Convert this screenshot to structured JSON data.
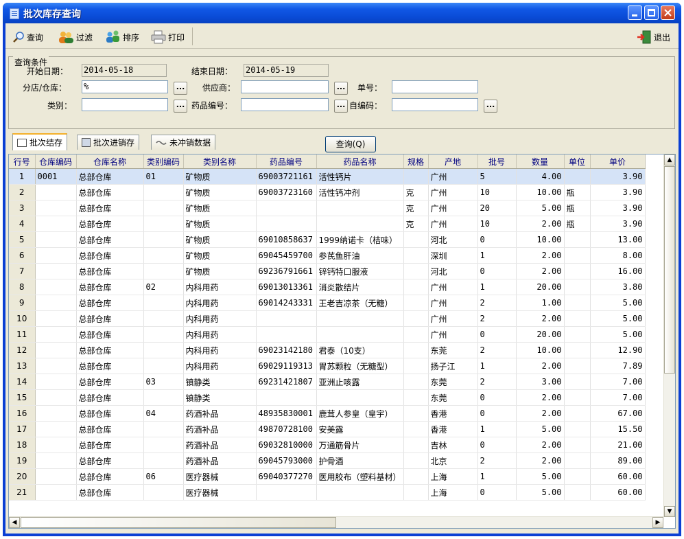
{
  "window": {
    "title": "批次库存查询"
  },
  "toolbar": {
    "query": "查询",
    "filter": "过滤",
    "sort": "排序",
    "print": "打印",
    "exit": "退出"
  },
  "conditions": {
    "group_title": "查询条件",
    "start_date_label": "开始日期：",
    "start_date": "2014-05-18",
    "end_date_label": "结束日期：",
    "end_date": "2014-05-19",
    "store_label": "分店/仓库：",
    "store": "%",
    "supplier_label": "供应商：",
    "supplier": "",
    "order_label": "单号：",
    "order_no": "",
    "category_label": "类别：",
    "category": "",
    "drug_code_label": "药品编号：",
    "drug_code": "",
    "self_code_label": "自编码：",
    "self_code": "",
    "ellipsis": "..."
  },
  "tabs": [
    "批次结存",
    "批次进销存",
    "未冲销数据"
  ],
  "query_button": "查询(Q)",
  "table": {
    "headers": [
      "行号",
      "仓库编码",
      "仓库名称",
      "类别编码",
      "类别名称",
      "药品编号",
      "药品名称",
      "规格",
      "产地",
      "批号",
      "数量",
      "单位",
      "单价"
    ],
    "rows": [
      [
        "1",
        "0001",
        "总部仓库",
        "01",
        "矿物质",
        "69003721161",
        "活性钙片",
        "",
        "广州",
        "5",
        "4.00",
        "",
        "3.90"
      ],
      [
        "2",
        "",
        "总部仓库",
        "",
        "矿物质",
        "69003723160",
        "活性钙冲剂",
        "克",
        "广州",
        "10",
        "10.00",
        "瓶",
        "3.90"
      ],
      [
        "3",
        "",
        "总部仓库",
        "",
        "矿物质",
        "",
        "",
        "克",
        "广州",
        "20",
        "5.00",
        "瓶",
        "3.90"
      ],
      [
        "4",
        "",
        "总部仓库",
        "",
        "矿物质",
        "",
        "",
        "克",
        "广州",
        "10",
        "2.00",
        "瓶",
        "3.90"
      ],
      [
        "5",
        "",
        "总部仓库",
        "",
        "矿物质",
        "69010858637",
        "1999纳诺卡（桔味）",
        "",
        "河北",
        "0",
        "10.00",
        "",
        "13.00"
      ],
      [
        "6",
        "",
        "总部仓库",
        "",
        "矿物质",
        "69045459700",
        "参芪鱼肝油",
        "",
        "深圳",
        "1",
        "2.00",
        "",
        "8.00"
      ],
      [
        "7",
        "",
        "总部仓库",
        "",
        "矿物质",
        "69236791661",
        "锌钙特口服液",
        "",
        "河北",
        "0",
        "2.00",
        "",
        "16.00"
      ],
      [
        "8",
        "",
        "总部仓库",
        "02",
        "内科用药",
        "69013013361",
        "消炎散结片",
        "",
        "广州",
        "1",
        "20.00",
        "",
        "3.80"
      ],
      [
        "9",
        "",
        "总部仓库",
        "",
        "内科用药",
        "69014243331",
        "王老吉凉茶（无糖）",
        "",
        "广州",
        "2",
        "1.00",
        "",
        "5.00"
      ],
      [
        "10",
        "",
        "总部仓库",
        "",
        "内科用药",
        "",
        "",
        "",
        "广州",
        "2",
        "2.00",
        "",
        "5.00"
      ],
      [
        "11",
        "",
        "总部仓库",
        "",
        "内科用药",
        "",
        "",
        "",
        "广州",
        "0",
        "20.00",
        "",
        "5.00"
      ],
      [
        "12",
        "",
        "总部仓库",
        "",
        "内科用药",
        "69023142180",
        "君泰（10支）",
        "",
        "东莞",
        "2",
        "10.00",
        "",
        "12.90"
      ],
      [
        "13",
        "",
        "总部仓库",
        "",
        "内科用药",
        "69029119313",
        "胃苏颗粒（无糖型）",
        "",
        "扬子江",
        "1",
        "2.00",
        "",
        "7.89"
      ],
      [
        "14",
        "",
        "总部仓库",
        "03",
        "镇静类",
        "69231421807",
        "亚洲止咳露",
        "",
        "东莞",
        "2",
        "3.00",
        "",
        "7.00"
      ],
      [
        "15",
        "",
        "总部仓库",
        "",
        "镇静类",
        "",
        "",
        "",
        "东莞",
        "0",
        "2.00",
        "",
        "7.00"
      ],
      [
        "16",
        "",
        "总部仓库",
        "04",
        "药酒补品",
        "48935830001",
        "鹿茸人参皇（皇宇）",
        "",
        "香港",
        "0",
        "2.00",
        "",
        "67.00"
      ],
      [
        "17",
        "",
        "总部仓库",
        "",
        "药酒补品",
        "49870728100",
        "安美露",
        "",
        "香港",
        "1",
        "5.00",
        "",
        "15.50"
      ],
      [
        "18",
        "",
        "总部仓库",
        "",
        "药酒补品",
        "69032810000",
        "万通筋骨片",
        "",
        "吉林",
        "0",
        "2.00",
        "",
        "21.00"
      ],
      [
        "19",
        "",
        "总部仓库",
        "",
        "药酒补品",
        "69045793000",
        "护骨酒",
        "",
        "北京",
        "2",
        "2.00",
        "",
        "89.00"
      ],
      [
        "20",
        "",
        "总部仓库",
        "06",
        "医疗器械",
        "69040377270",
        "医用胶布（塑料基材）",
        "",
        "上海",
        "1",
        "5.00",
        "",
        "60.00"
      ],
      [
        "21",
        "",
        "总部仓库",
        "",
        "医疗器械",
        "",
        "",
        "",
        "上海",
        "0",
        "5.00",
        "",
        "60.00"
      ]
    ]
  }
}
